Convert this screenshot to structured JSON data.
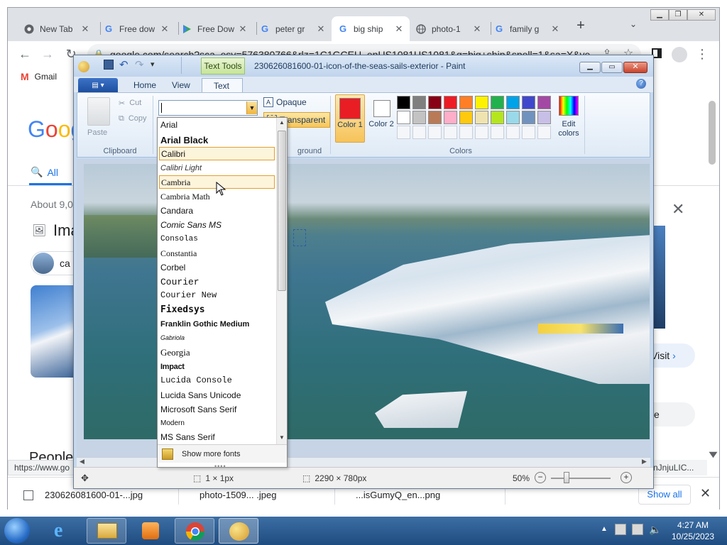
{
  "browser": {
    "tabs": [
      {
        "title": "New Tab",
        "icon": "chrome-icon"
      },
      {
        "title": "Free dow",
        "icon": "google-icon"
      },
      {
        "title": "Free Dow",
        "icon": "play-store-icon"
      },
      {
        "title": "peter gr",
        "icon": "google-icon"
      },
      {
        "title": "big ship",
        "icon": "google-icon"
      },
      {
        "title": "photo-1",
        "icon": "globe-icon"
      },
      {
        "title": "family g",
        "icon": "google-icon"
      }
    ],
    "url": "google.com/search?sca_esv=576380766&rlz=1C1GCEU_enUS1081US1081&q=big+ship&spell=1&sa=X&ve",
    "bookmark": "Gmail",
    "status_url": "https://www.go",
    "status_url_tail": "nJnjuLIC..."
  },
  "google": {
    "logo": "Goog",
    "tab_all": "All",
    "results_count": "About 9,0",
    "images_heading": "Ima",
    "chip_label": "ca",
    "visit_label": "Visit",
    "more_label": "e",
    "people_heading": "People",
    "downloads": [
      "230626081600-01-...jpg",
      "photo-1509... .jpeg",
      "...isGumyQ_en...png"
    ],
    "show_all": "Show all"
  },
  "paint": {
    "title": "230626081600-01-icon-of-the-seas-sails-exterior - Paint",
    "contextual_tab": "Text Tools",
    "tabs": [
      "Home",
      "View",
      "Text"
    ],
    "clipboard": {
      "paste": "Paste",
      "cut": "Cut",
      "copy": "Copy",
      "label": "Clipboard"
    },
    "background": {
      "opaque": "Opaque",
      "transparent": "Transparent",
      "label_fragment": "ground"
    },
    "colors": {
      "color1_label": "Color 1",
      "color2_label": "Color 2",
      "edit_label": "Edit colors",
      "group_label": "Colors",
      "color1": "#e81e24",
      "color2": "#ffffff",
      "palette_row1": [
        "#000000",
        "#7f7f7f",
        "#880015",
        "#ed1c24",
        "#ff7f27",
        "#fff200",
        "#22b14c",
        "#00a2e8",
        "#3f48cc",
        "#a349a4"
      ],
      "palette_row2": [
        "#ffffff",
        "#c3c3c3",
        "#b97a57",
        "#ffaec9",
        "#ffc90e",
        "#efe4b0",
        "#b5e61d",
        "#99d9ea",
        "#7092be",
        "#c8bfe7"
      ]
    },
    "font_list": [
      "Arial",
      "Arial Black",
      "Calibri",
      "Calibri Light",
      "Cambria",
      "Cambria Math",
      "Candara",
      "Comic Sans MS",
      "Consolas",
      "Constantia",
      "Corbel",
      "Courier",
      "Courier New",
      "Fixedsys",
      "Franklin Gothic Medium",
      "Gabriola",
      "Georgia",
      "Impact",
      "Lucida Console",
      "Lucida Sans Unicode",
      "Microsoft Sans Serif",
      "Modern",
      "MS Sans Serif"
    ],
    "show_more_fonts": "Show more fonts",
    "status": {
      "selection": "1 × 1px",
      "image_size": "2290 × 780px",
      "zoom": "50%"
    }
  },
  "taskbar": {
    "time": "4:27 AM",
    "date": "10/25/2023"
  }
}
